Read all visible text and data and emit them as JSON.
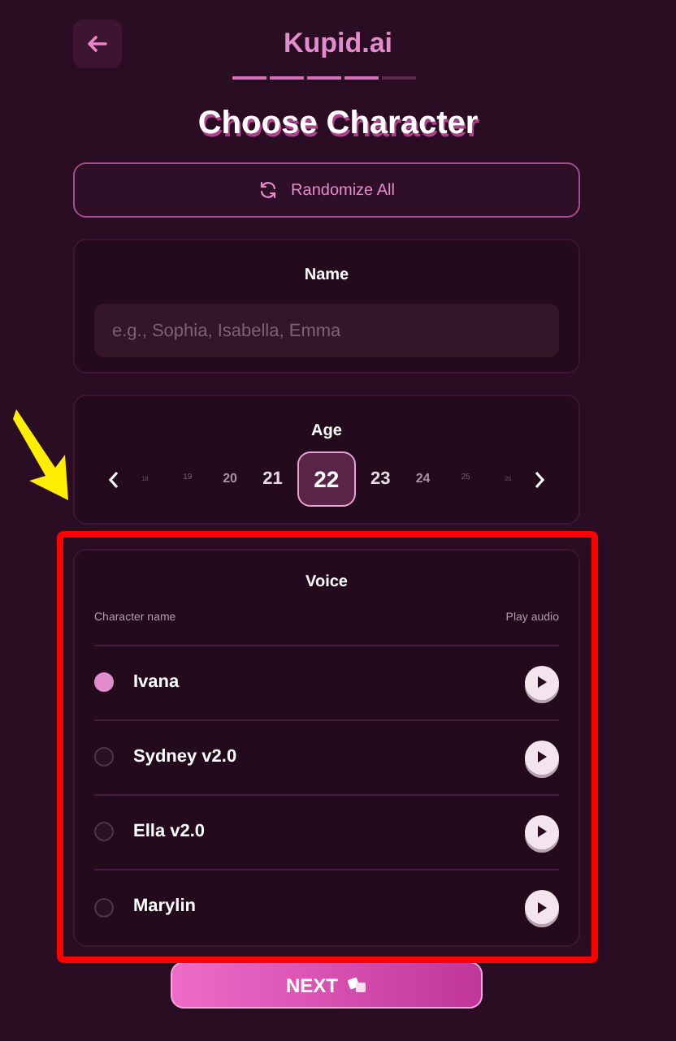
{
  "header": {
    "title": "Kupid.ai",
    "progress": [
      {
        "done": true
      },
      {
        "done": true
      },
      {
        "done": true
      },
      {
        "done": true
      },
      {
        "done": false
      }
    ]
  },
  "heading": "Choose Character",
  "randomize_button": "Randomize All",
  "name_card": {
    "label": "Name",
    "placeholder": "e.g., Sophia, Isabella, Emma"
  },
  "age_card": {
    "label": "Age",
    "ages": [
      {
        "value": "18",
        "selected": false
      },
      {
        "value": "19",
        "selected": false
      },
      {
        "value": "20",
        "selected": false
      },
      {
        "value": "21",
        "selected": false
      },
      {
        "value": "22",
        "selected": true
      },
      {
        "value": "23",
        "selected": false
      },
      {
        "value": "24",
        "selected": false
      },
      {
        "value": "25",
        "selected": false
      },
      {
        "value": "26",
        "selected": false
      }
    ]
  },
  "voice_card": {
    "label": "Voice",
    "columns": [
      "Character name",
      "Play audio"
    ],
    "voices": [
      {
        "name": "Ivana",
        "selected": true
      },
      {
        "name": "Sydney v2.0",
        "selected": false
      },
      {
        "name": "Ella v2.0",
        "selected": false
      },
      {
        "name": "Marylin",
        "selected": false
      }
    ]
  },
  "next_button": "NEXT"
}
